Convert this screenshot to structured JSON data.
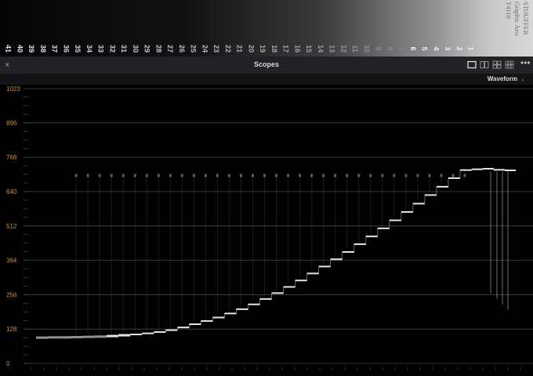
{
  "stepwedge": {
    "numbers": [
      "41",
      "40",
      "39",
      "38",
      "37",
      "36",
      "35",
      "34",
      "33",
      "32",
      "31",
      "30",
      "29",
      "28",
      "27",
      "26",
      "25",
      "24",
      "23",
      "22",
      "21",
      "20",
      "19",
      "18",
      "17",
      "16",
      "15",
      "14",
      "13",
      "12",
      "11",
      "10",
      "9",
      "8",
      "7",
      "6",
      "5",
      "4",
      "3",
      "2",
      "1"
    ],
    "brand_lines": [
      "STOUFFER",
      "Graphic Arts",
      "T4110"
    ]
  },
  "panel": {
    "title": "Scopes",
    "close_glyph": "×",
    "more_glyph": "•••",
    "scope_mode": "Waveform",
    "scope_mode_chevron": "⌄"
  },
  "colors": {
    "accent_label": "#c8933c",
    "gridline": "#6a5a3a",
    "trace": "#f2f2f2",
    "panel_bg": "#222226"
  },
  "chart_data": {
    "type": "line",
    "ylim": [
      0,
      1023
    ],
    "y_ticks": [
      "0",
      "128",
      "256",
      "384",
      "512",
      "640",
      "768",
      "896",
      "1023"
    ],
    "series": [
      {
        "values": [
          96,
          97,
          97,
          98,
          99,
          100,
          102,
          105,
          108,
          112,
          117,
          124,
          134,
          146,
          158,
          171,
          186,
          202,
          220,
          240,
          262,
          285,
          309,
          335,
          361,
          388,
          415,
          444,
          473,
          503,
          533,
          564,
          595,
          627,
          658,
          690,
          720,
          723,
          725,
          721,
          719
        ]
      }
    ]
  }
}
